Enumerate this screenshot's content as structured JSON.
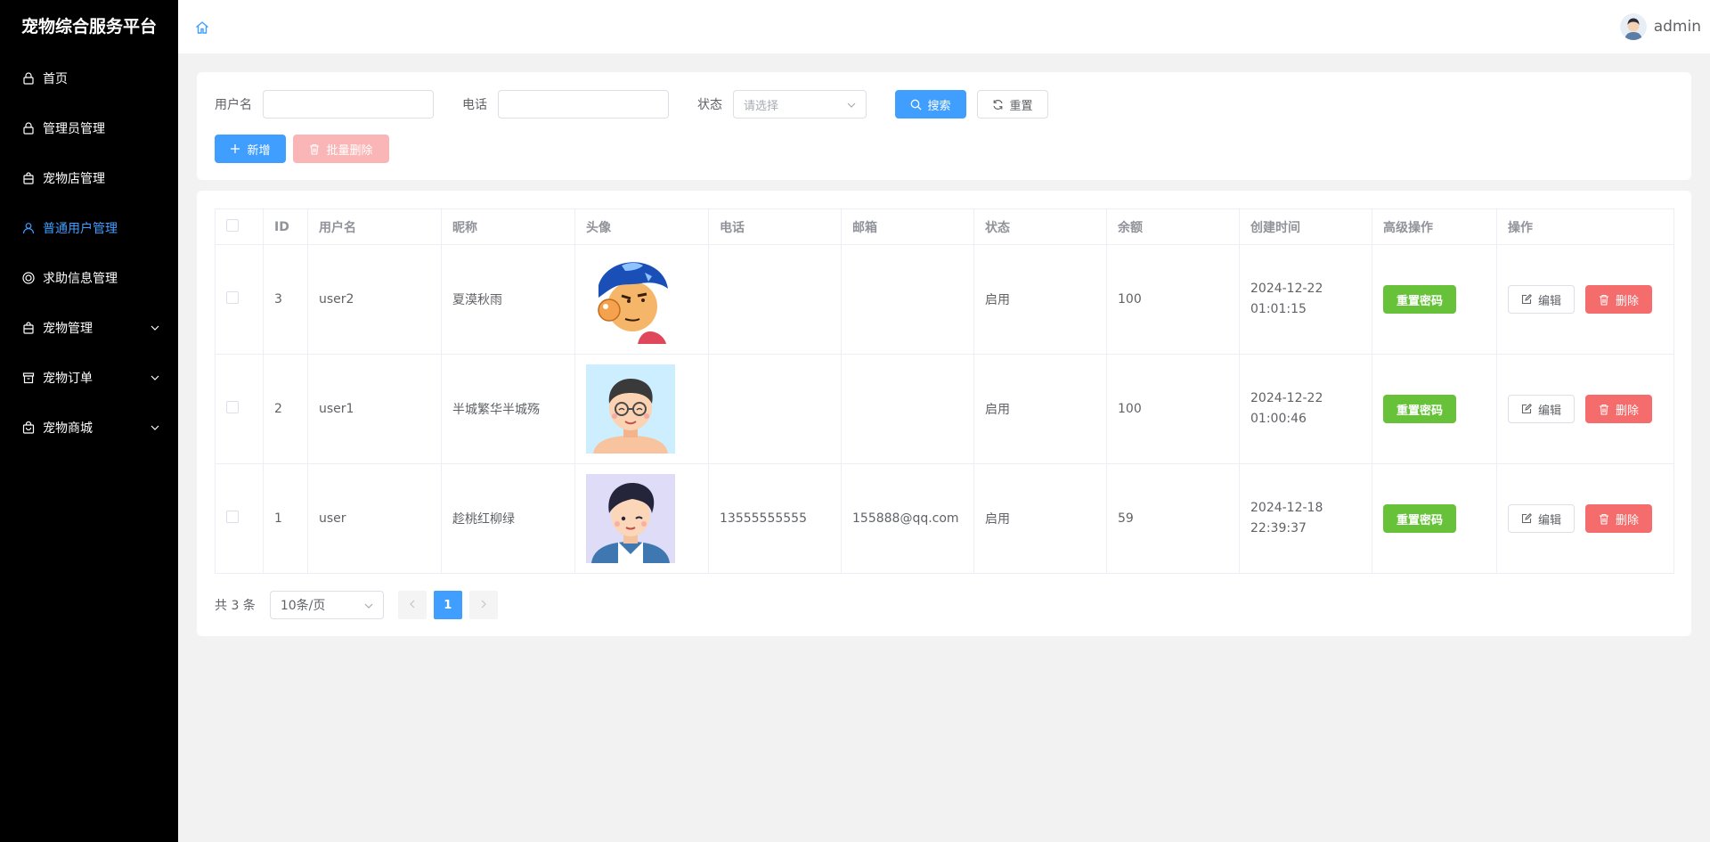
{
  "app": {
    "title": "宠物综合服务平台"
  },
  "sidebar": {
    "items": [
      {
        "label": "首页",
        "icon": "lock-icon",
        "active": false,
        "expandable": false
      },
      {
        "label": "管理员管理",
        "icon": "lock-icon",
        "active": false,
        "expandable": false
      },
      {
        "label": "宠物店管理",
        "icon": "shopping-bag-icon",
        "active": false,
        "expandable": false
      },
      {
        "label": "普通用户管理",
        "icon": "user-icon",
        "active": true,
        "expandable": false
      },
      {
        "label": "求助信息管理",
        "icon": "help-circle-icon",
        "active": false,
        "expandable": false
      },
      {
        "label": "宠物管理",
        "icon": "shopping-bag-icon",
        "active": false,
        "expandable": true
      },
      {
        "label": "宠物订单",
        "icon": "box-icon",
        "active": false,
        "expandable": true
      },
      {
        "label": "宠物商城",
        "icon": "shop-bag-icon",
        "active": false,
        "expandable": true
      }
    ]
  },
  "header": {
    "username": "admin"
  },
  "search": {
    "username_label": "用户名",
    "phone_label": "电话",
    "status_label": "状态",
    "status_placeholder": "请选择",
    "search_button": "搜索",
    "reset_button": "重置",
    "add_button": "新增",
    "batch_delete_button": "批量删除"
  },
  "table": {
    "columns": [
      "ID",
      "用户名",
      "昵称",
      "头像",
      "电话",
      "邮箱",
      "状态",
      "余额",
      "创建时间",
      "高级操作",
      "操作"
    ],
    "rows": [
      {
        "id": "3",
        "username": "user2",
        "nickname": "夏漠秋雨",
        "avatar": "cartoon-blue-hair",
        "phone": "",
        "email": "",
        "status": "启用",
        "balance": "100",
        "created_date": "2024-12-22",
        "created_time": "01:01:15"
      },
      {
        "id": "2",
        "username": "user1",
        "nickname": "半城繁华半城殇",
        "avatar": "cartoon-glasses",
        "phone": "",
        "email": "",
        "status": "启用",
        "balance": "100",
        "created_date": "2024-12-22",
        "created_time": "01:00:46"
      },
      {
        "id": "1",
        "username": "user",
        "nickname": "趁桃红柳绿",
        "avatar": "cartoon-boy",
        "phone": "13555555555",
        "email": "155888@qq.com",
        "status": "启用",
        "balance": "59",
        "created_date": "2024-12-18",
        "created_time": "22:39:37"
      }
    ],
    "reset_password_label": "重置密码",
    "edit_label": "编辑",
    "delete_label": "删除"
  },
  "pagination": {
    "total_text": "共 3 条",
    "page_size": "10条/页",
    "current_page": "1"
  },
  "colors": {
    "primary": "#409eff",
    "success": "#67c23a",
    "danger": "#f56c6c",
    "sidebar_bg": "#000000"
  }
}
